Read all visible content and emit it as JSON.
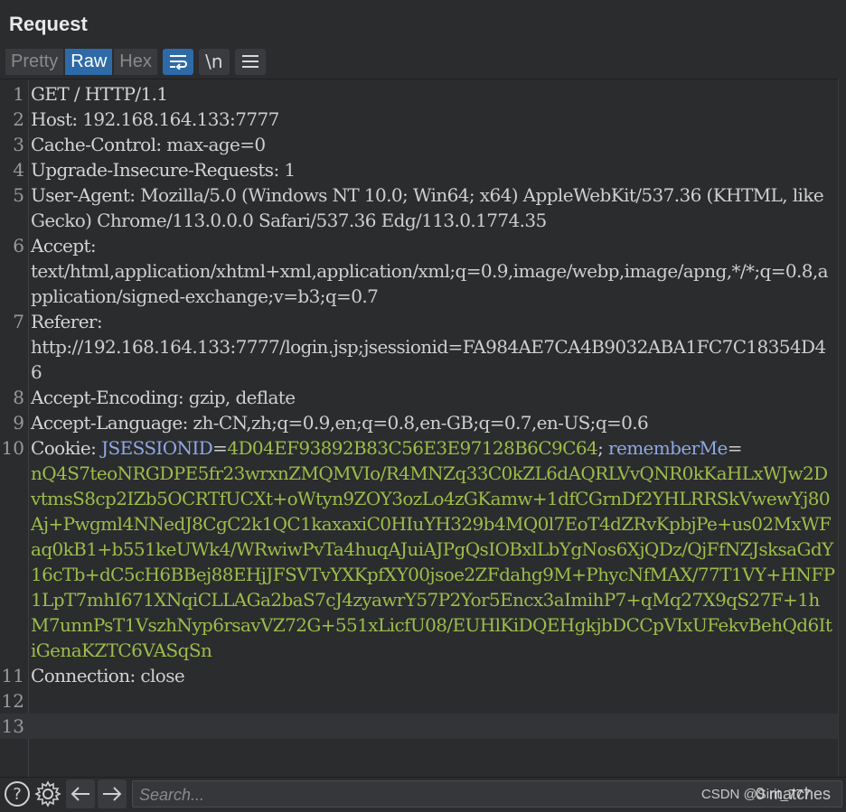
{
  "panel": {
    "title": "Request"
  },
  "toolbar": {
    "tabs": [
      "Pretty",
      "Raw",
      "Hex"
    ],
    "active_tab": "Raw",
    "newline_label": "\\n"
  },
  "lines": [
    {
      "n": "1",
      "parts": [
        {
          "t": "GET / HTTP/1.1",
          "c": "k"
        }
      ]
    },
    {
      "n": "2",
      "parts": [
        {
          "t": "Host",
          "c": "k"
        },
        {
          "t": ": 192.168.164.133:7777",
          "c": "v"
        }
      ]
    },
    {
      "n": "3",
      "parts": [
        {
          "t": "Cache-Control",
          "c": "k"
        },
        {
          "t": ": max-age=0",
          "c": "v"
        }
      ]
    },
    {
      "n": "4",
      "parts": [
        {
          "t": "Upgrade-Insecure-Requests",
          "c": "k"
        },
        {
          "t": ": 1",
          "c": "v"
        }
      ]
    },
    {
      "n": "5",
      "parts": [
        {
          "t": "User-Agent",
          "c": "k"
        },
        {
          "t": ": Mozilla/5.0 (Windows NT 10.0; Win64; x64) AppleWebKit/537.36 (KHTML, like Gecko) Chrome/113.0.0.0 Safari/537.36 Edg/113.0.1774.35",
          "c": "v"
        }
      ]
    },
    {
      "n": "6",
      "parts": [
        {
          "t": "Accept",
          "c": "k"
        },
        {
          "t": ":\ntext/html,application/xhtml+xml,application/xml;q=0.9,image/webp,image/apng,*/*;q=0.8,application/signed-exchange;v=b3;q=0.7",
          "c": "v"
        }
      ]
    },
    {
      "n": "7",
      "parts": [
        {
          "t": "Referer",
          "c": "k"
        },
        {
          "t": ":\nhttp://192.168.164.133:7777/login.jsp;jsessionid=FA984AE7CA4B9032ABA1FC7C18354D46",
          "c": "v"
        }
      ]
    },
    {
      "n": "8",
      "parts": [
        {
          "t": "Accept-Encoding",
          "c": "k"
        },
        {
          "t": ": gzip, deflate",
          "c": "v"
        }
      ]
    },
    {
      "n": "9",
      "parts": [
        {
          "t": "Accept-Language",
          "c": "k"
        },
        {
          "t": ": zh-CN,zh;q=0.9,en;q=0.8,en-GB;q=0.7,en-US;q=0.6",
          "c": "v"
        }
      ]
    },
    {
      "n": "10",
      "parts": [
        {
          "t": "Cookie",
          "c": "k"
        },
        {
          "t": ": ",
          "c": "v"
        },
        {
          "t": "JSESSIONID",
          "c": "ck"
        },
        {
          "t": "=",
          "c": "v"
        },
        {
          "t": "4D04EF93892B83C56E3E97128B6C9C64",
          "c": "cv"
        },
        {
          "t": "; ",
          "c": "v"
        },
        {
          "t": "rememberMe",
          "c": "ck"
        },
        {
          "t": "=\n",
          "c": "v"
        },
        {
          "t": "nQ4S7teoNRGDPE5fr23wrxnZMQMVIo/R4MNZq33C0kZL6dAQRLVvQNR0kKaHLxWJw2DvtmsS8cp2IZb5OCRTfUCXt+oWtyn9ZOY3ozLo4zGKamw+1dfCGrnDf2YHLRRSkVwewYj80Aj+Pwgml4NNedJ8CgC2k1QC1kaxaxiC0HIuYH329b4MQ0l7EoT4dZRvKpbjPe+us02MxWFaq0kB1+b551keUWk4/WRwiwPvTa4huqAJuiAJPgQsIOBxlLbYgNos6XjQDz/QjFfNZJsksaGdY16cTb+dC5cH6BBej88EHjJFSVTvYXKpfXY00jsoe2ZFdahg9M+PhycNfMAX/77T1VY+HNFP1LpT7mhI671XNqiCLLAGa2baS7cJ4zyawrY57P2Yor5Encx3aImihP7+qMq27X9qS27F+1hM7unnPsT1VszhNyp6rsavVZ72G+551xLicfU08/EUHlKiDQEHgkjbDCCpVIxUFekvBehQd6ItiGenaKZTC6VASqSn",
          "c": "cv"
        }
      ]
    },
    {
      "n": "11",
      "parts": [
        {
          "t": "Connection",
          "c": "k"
        },
        {
          "t": ": close",
          "c": "v"
        }
      ]
    },
    {
      "n": "12",
      "parts": []
    },
    {
      "n": "13",
      "parts": []
    }
  ],
  "current_line": "13",
  "colors": {
    "key": "#d4d4d4",
    "value": "#cfcfcf",
    "cookie_key": "#8fa9e6",
    "cookie_value": "#9dbd4a",
    "active_tab": "#2e6aa8"
  },
  "footer": {
    "search_placeholder": "Search...",
    "matches_label": "0 matches",
    "watermark": "CSDN @Sirit_777",
    "icons": [
      "help-icon",
      "settings-icon",
      "arrow-left-icon",
      "arrow-right-icon"
    ]
  }
}
